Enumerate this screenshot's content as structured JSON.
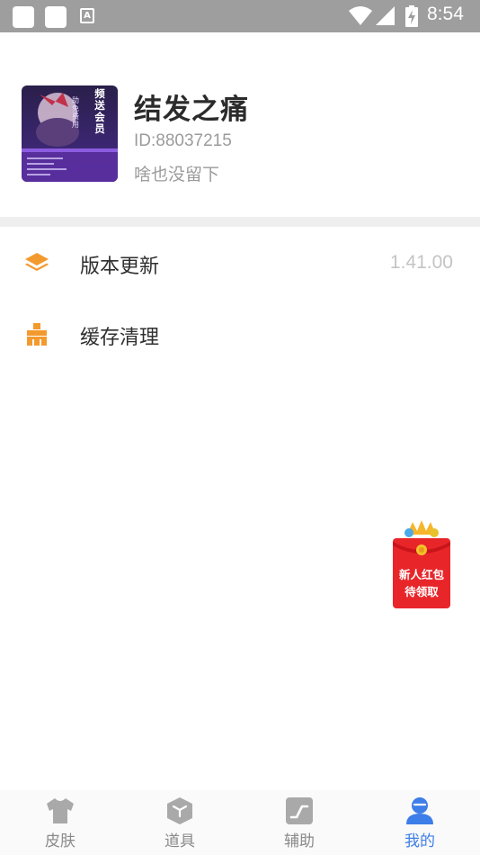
{
  "status_bar": {
    "time": "8:54",
    "notification_icons": [
      "square-notification-icon",
      "square-notification-icon",
      "text-notification-icon"
    ],
    "system_icons": [
      "wifi-icon",
      "cellular-signal-icon",
      "battery-charging-icon"
    ]
  },
  "profile": {
    "name": "结发之痛",
    "id": "ID:88037215",
    "bio": "啥也没留下",
    "avatar_text": [
      "频",
      "送",
      "会",
      "员",
      "助",
      "免",
      "费",
      "用"
    ]
  },
  "menu": {
    "items": [
      {
        "label": "版本更新",
        "value": "1.41.00",
        "icon": "layers-icon"
      },
      {
        "label": "缓存清理",
        "icon": "broom-icon"
      }
    ]
  },
  "red_packet": {
    "line1": "新人红包",
    "line2": "待领取"
  },
  "tabs": [
    {
      "label": "皮肤",
      "icon": "tshirt-icon",
      "active": false
    },
    {
      "label": "道具",
      "icon": "cube-icon",
      "active": false
    },
    {
      "label": "辅助",
      "icon": "chart-line-icon",
      "active": false
    },
    {
      "label": "我的",
      "icon": "user-icon",
      "active": true
    }
  ],
  "colors": {
    "accent_orange": "#f39a2e",
    "tab_active": "#3d7ee8",
    "tab_inactive": "#8a8a8a",
    "red_packet": "#e8262a"
  }
}
